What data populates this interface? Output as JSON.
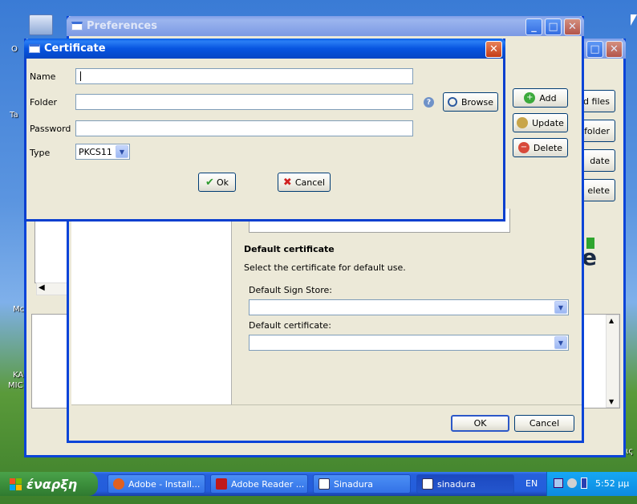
{
  "desktop": {
    "left_text_1": "O",
    "left_text_2": "Ta",
    "left_text_3": "Mc",
    "left_text_4": "KA",
    "left_text_5": "MIC",
    "right_text": "ις"
  },
  "back_window": {
    "buttons": {
      "add_files": "d files",
      "folder": "folder",
      "update": "date",
      "delete": "elete"
    },
    "logo_text": "e"
  },
  "preferences": {
    "title": "Preferences",
    "buttons": {
      "add": "Add",
      "update": "Update",
      "delete": "Delete",
      "ok": "OK",
      "cancel": "Cancel"
    },
    "default_cert": {
      "heading": "Default certificate",
      "description": "Select the certificate for default use.",
      "sign_store_label": "Default Sign Store:",
      "sign_store_value": "",
      "certificate_label": "Default certificate:",
      "certificate_value": ""
    }
  },
  "certificate_dialog": {
    "title": "Certificate",
    "labels": {
      "name": "Name",
      "folder": "Folder",
      "password": "Password",
      "type": "Type"
    },
    "values": {
      "name": "",
      "folder": "",
      "password": "",
      "type": "PKCS11"
    },
    "browse": "Browse",
    "ok": "Ok",
    "cancel": "Cancel"
  },
  "taskbar": {
    "start": "έναρξη",
    "tasks": [
      "Adobe - Install...",
      "Adobe Reader ...",
      "Sinadura",
      "sinadura"
    ],
    "language": "EN",
    "clock": "5:52 μμ"
  }
}
